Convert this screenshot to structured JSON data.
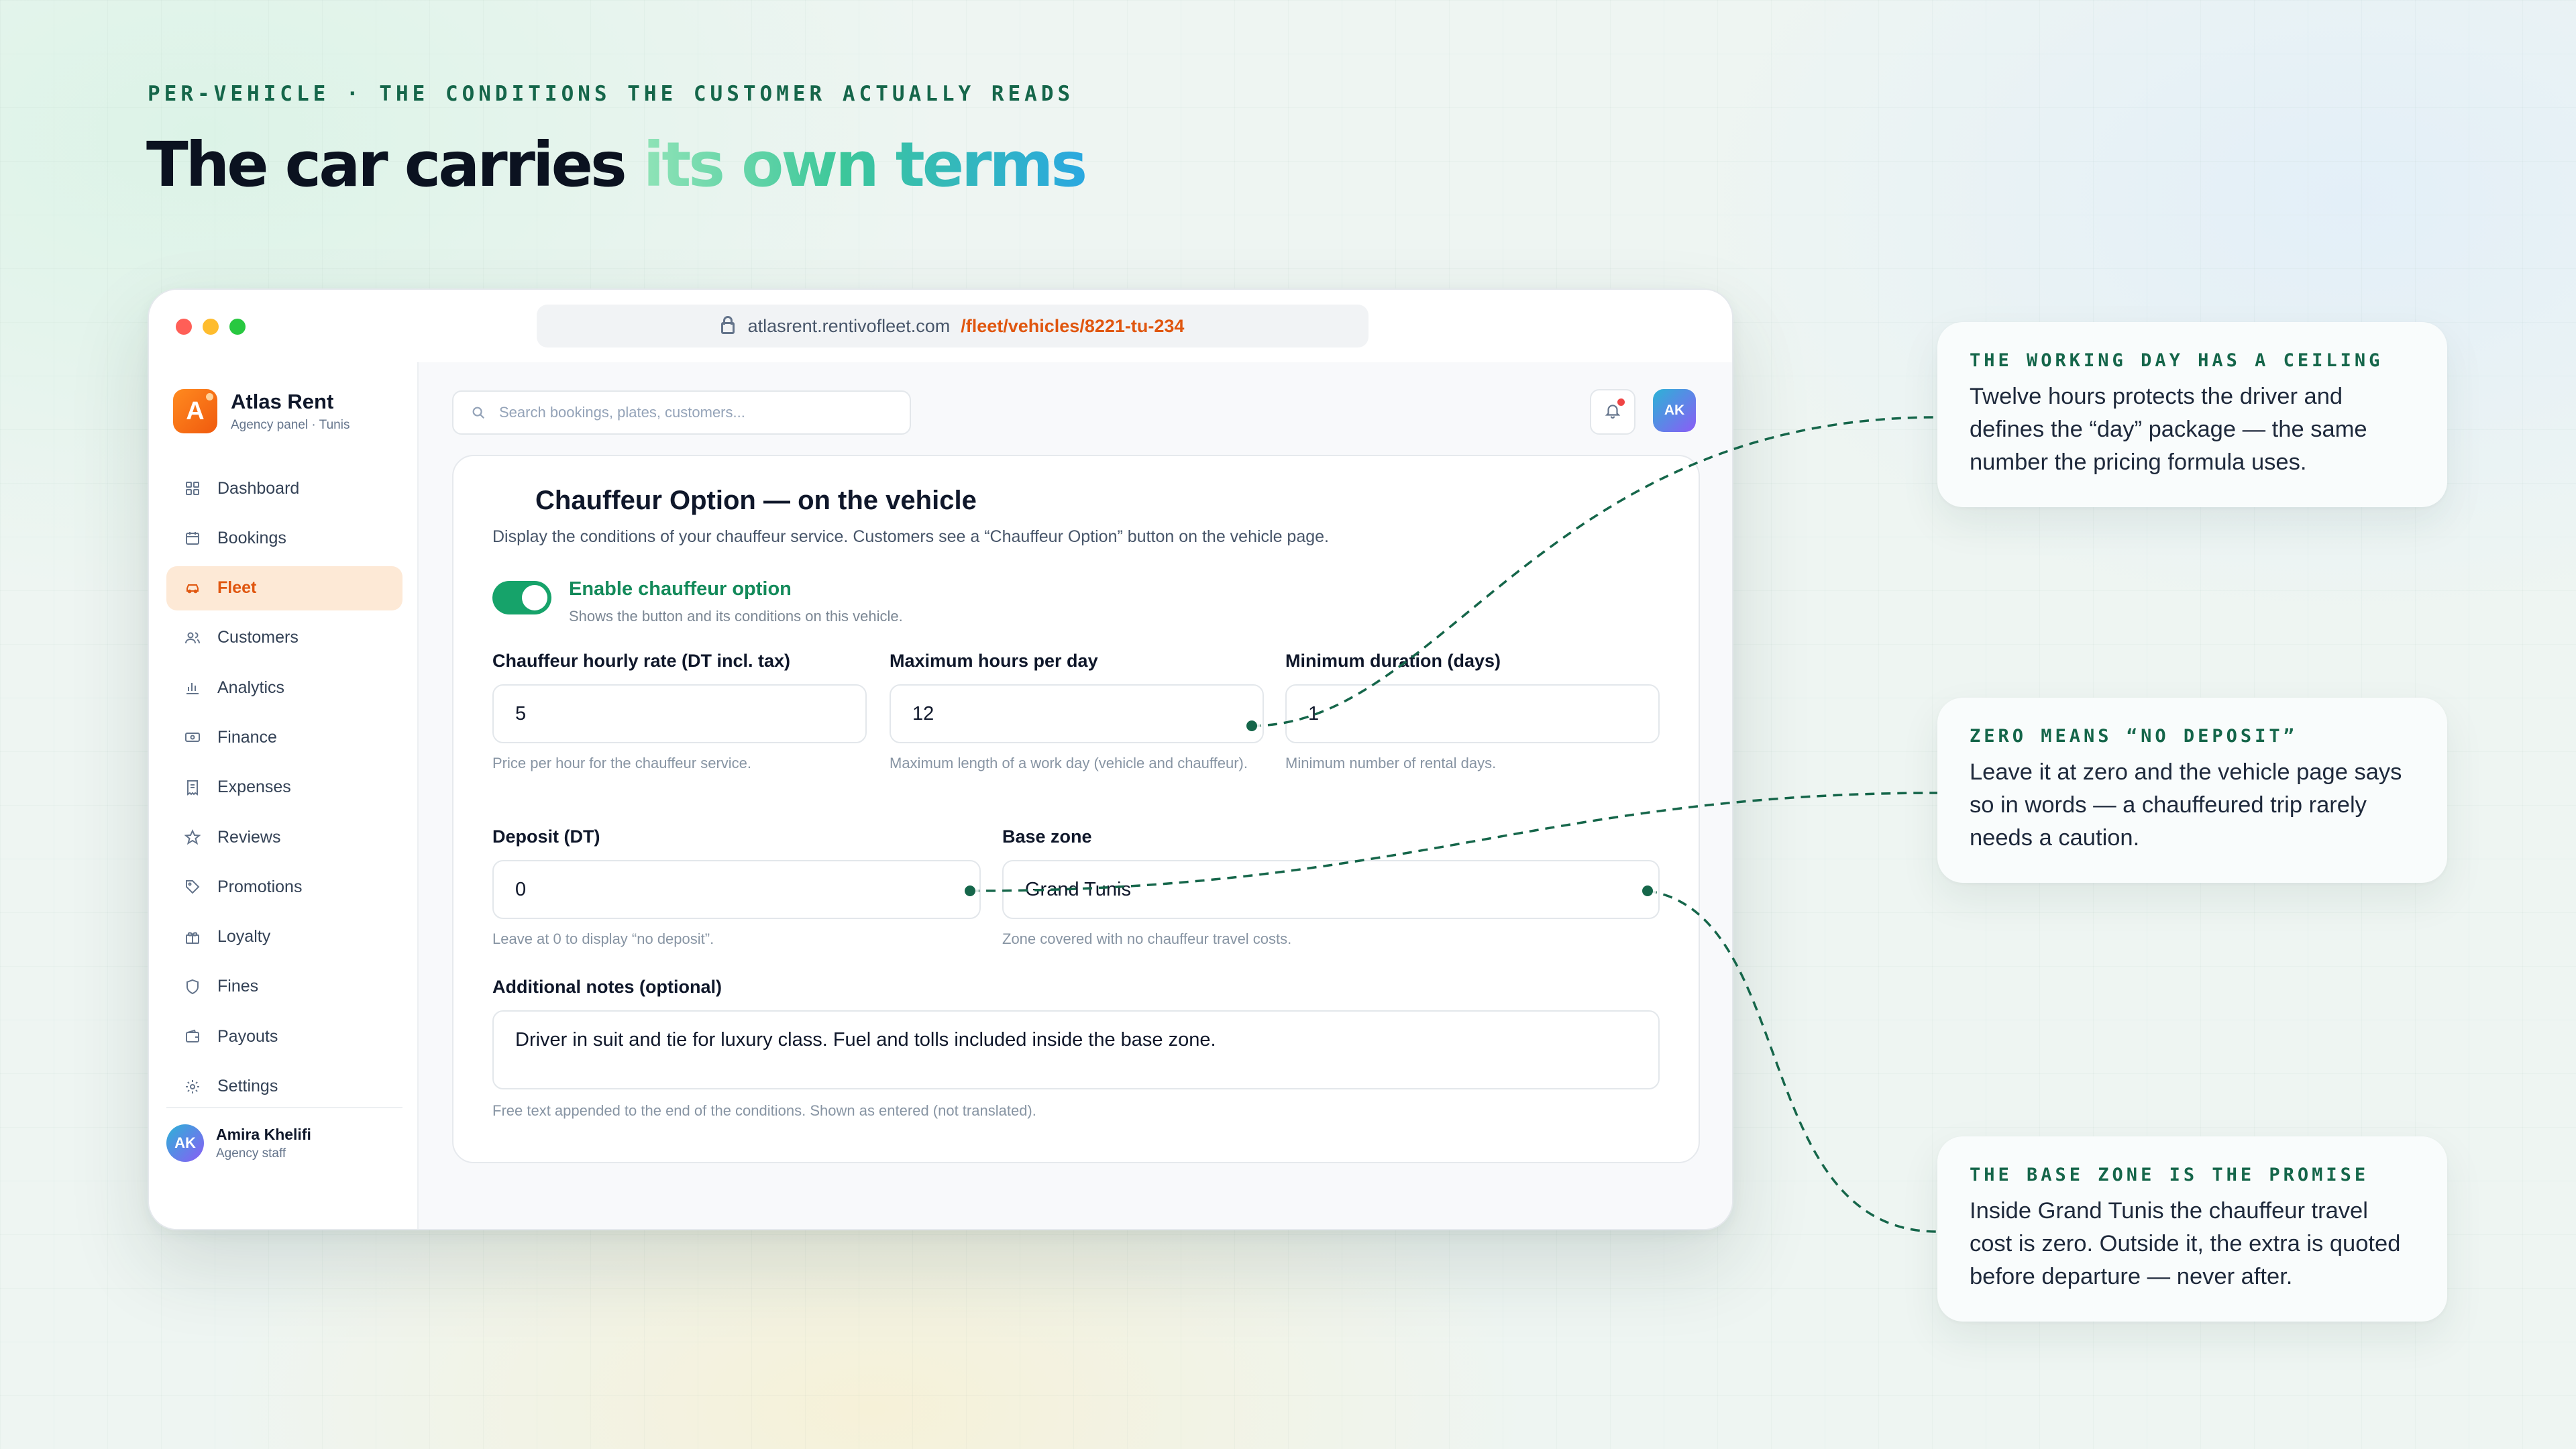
{
  "eyebrow": "PER-VEHICLE · THE CONDITIONS THE CUSTOMER ACTUALLY READS",
  "headline": {
    "part1": "The car carries ",
    "accent": "its own terms"
  },
  "browser": {
    "url_host": "atlasrent.rentivofleet.com",
    "url_path": "/fleet/vehicles/8221-tu-234"
  },
  "brand": {
    "logo_letter": "A",
    "name": "Atlas Rent",
    "subtitle": "Agency panel · Tunis"
  },
  "sidebar": {
    "items": [
      {
        "label": "Dashboard",
        "icon": "grid-icon"
      },
      {
        "label": "Bookings",
        "icon": "calendar-icon"
      },
      {
        "label": "Fleet",
        "icon": "car-icon",
        "active": true
      },
      {
        "label": "Customers",
        "icon": "users-icon"
      },
      {
        "label": "Analytics",
        "icon": "bar-chart-icon"
      },
      {
        "label": "Finance",
        "icon": "banknote-icon"
      },
      {
        "label": "Expenses",
        "icon": "receipt-icon"
      },
      {
        "label": "Reviews",
        "icon": "star-icon"
      },
      {
        "label": "Promotions",
        "icon": "tag-icon"
      },
      {
        "label": "Loyalty",
        "icon": "gift-icon"
      },
      {
        "label": "Fines",
        "icon": "shield-icon"
      },
      {
        "label": "Payouts",
        "icon": "wallet-icon"
      },
      {
        "label": "Settings",
        "icon": "gear-icon"
      }
    ],
    "user": {
      "initials": "AK",
      "name": "Amira Khelifi",
      "role": "Agency staff"
    }
  },
  "topbar": {
    "search_placeholder": "Search bookings, plates, customers...",
    "avatar_initials": "AK"
  },
  "form": {
    "title": "Chauffeur Option — on the vehicle",
    "description": "Display the conditions of your chauffeur service. Customers see a “Chauffeur Option” button on the vehicle page.",
    "toggle": {
      "label": "Enable chauffeur option",
      "sub": "Shows the button and its conditions on this vehicle.",
      "enabled": true
    },
    "hourly_rate": {
      "label": "Chauffeur hourly rate (DT incl. tax)",
      "value": "5",
      "help": "Price per hour for the chauffeur service."
    },
    "max_hours": {
      "label": "Maximum hours per day",
      "value": "12",
      "help": "Maximum length of a work day (vehicle and chauffeur)."
    },
    "min_duration": {
      "label": "Minimum duration (days)",
      "value": "1",
      "help": "Minimum number of rental days."
    },
    "deposit": {
      "label": "Deposit (DT)",
      "value": "0",
      "help": "Leave at 0 to display “no deposit”."
    },
    "base_zone": {
      "label": "Base zone",
      "value": "Grand Tunis",
      "help": "Zone covered with no chauffeur travel costs."
    },
    "notes": {
      "label": "Additional notes (optional)",
      "value": "Driver in suit and tie for luxury class. Fuel and tolls included inside the base zone.",
      "help": "Free text appended to the end of the conditions. Shown as entered (not translated)."
    }
  },
  "annotations": [
    {
      "title": "THE WORKING DAY HAS A CEILING",
      "body": "Twelve hours protects the driver and defines the “day” package — the same number the pricing formula uses."
    },
    {
      "title": "ZERO MEANS “NO DEPOSIT”",
      "body": "Leave it at zero and the vehicle page says so in words — a chauffeured trip rarely needs a caution."
    },
    {
      "title": "THE BASE ZONE IS THE PROMISE",
      "body": "Inside Grand Tunis the chauffeur travel cost is zero. Outside it, the extra is quoted before departure — never after."
    }
  ],
  "colors": {
    "accent_orange": "#e0560f",
    "accent_green": "#16a36a",
    "connector": "#15664a"
  }
}
